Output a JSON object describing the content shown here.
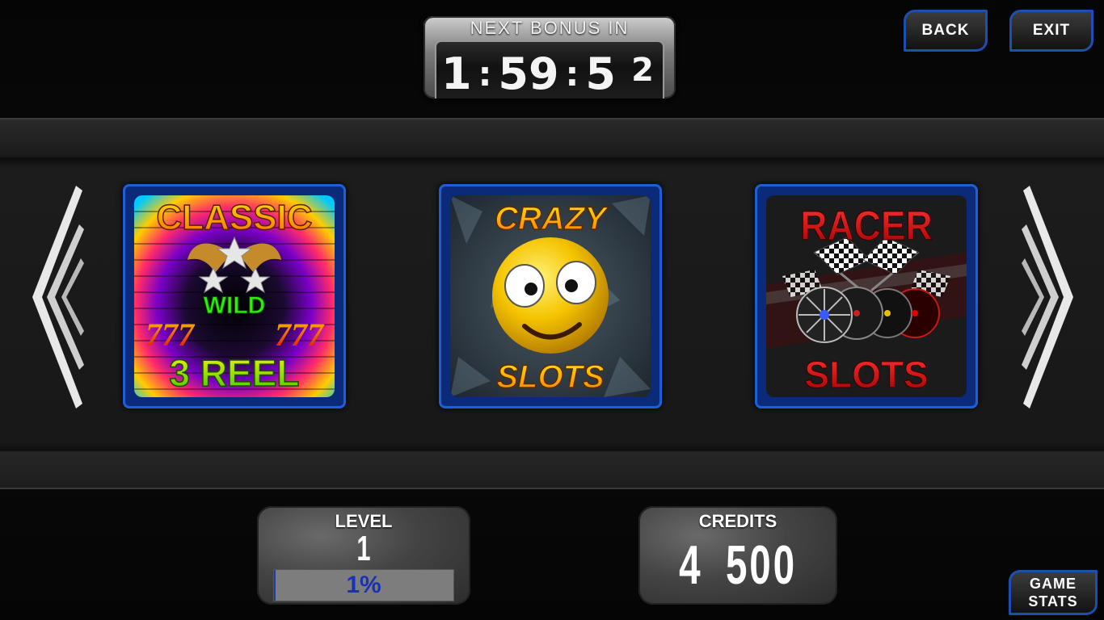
{
  "bonus": {
    "title": "NEXT BONUS IN",
    "hours": "1",
    "minutes": "59",
    "seconds_tens": "5",
    "seconds_ones_rolling": "2"
  },
  "buttons": {
    "back": "BACK",
    "exit": "EXIT",
    "game_stats_line1": "GAME",
    "game_stats_line2": "STATS"
  },
  "games": [
    {
      "line1": "CLASSIC",
      "mid": "WILD",
      "sevens": "777",
      "line2": "3 REEL"
    },
    {
      "line1": "CRAZY",
      "line2": "SLOTS"
    },
    {
      "line1": "RACER",
      "line2": "SLOTS"
    }
  ],
  "level": {
    "label": "LEVEL",
    "value": "1",
    "progress_text": "1%",
    "progress_fraction": 0.01
  },
  "credits": {
    "label": "CREDITS",
    "value": "4 500"
  },
  "colors": {
    "accent_blue": "#1f5fd6",
    "crazy_yellow": "#f5c400",
    "racer_red": "#d01818"
  }
}
